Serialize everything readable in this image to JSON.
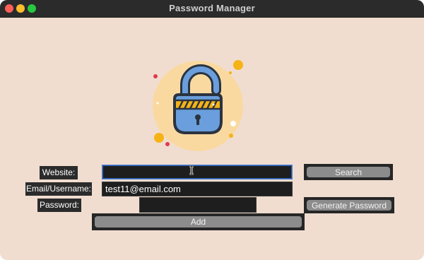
{
  "window": {
    "title": "Password Manager"
  },
  "form": {
    "website_label": "Website:",
    "website_value": "",
    "email_label": "Email/Username:",
    "email_value": "test11@email.com",
    "password_label": "Password:",
    "password_value": "",
    "search_button": "Search",
    "generate_button": "Generate Password",
    "add_button": "Add"
  },
  "colors": {
    "window_bg": "#f0ddd0",
    "lock_body": "#6a9edc",
    "lock_outline": "#2a3340",
    "stripe_yellow": "#f5b316",
    "logo_circle": "#fad9a1"
  },
  "icons": [
    "padlock-open-icon",
    "text-cursor-icon"
  ]
}
